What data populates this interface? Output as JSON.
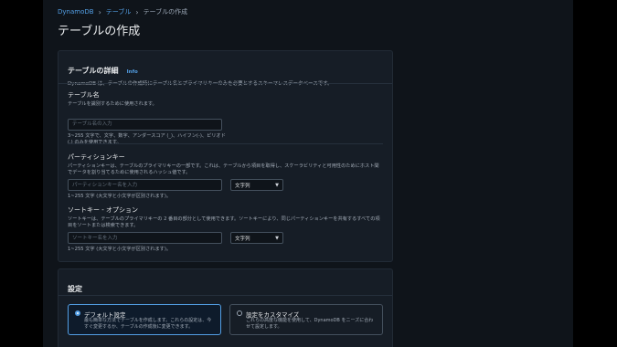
{
  "breadcrumb": {
    "root": "DynamoDB",
    "section": "テーブル",
    "current": "テーブルの作成"
  },
  "page_title": "テーブルの作成",
  "details": {
    "title": "テーブルの詳細",
    "info": "Info",
    "description": "DynamoDB は、テーブルの作成時にテーブル名とプライマリキーのみを必要とするスキーマレスデータベースです。",
    "table_name": {
      "label": "テーブル名",
      "description": "テーブルを識別するために使用されます。",
      "placeholder": "テーブル名の入力",
      "constraint": "3~255 文字で、文字、数字、アンダースコア (_)、ハイフン(-)、ピリオド (.) のみを使用できます。"
    },
    "partition_key": {
      "label": "パーティションキー",
      "description": "パーティションキーは、テーブルのプライマリキーの一部です。これは、テーブルから項目を取得し、スケーラビリティと可用性のためにホスト間でデータを割り当てるために使用されるハッシュ値です。",
      "placeholder": "パーティションキー名を入力",
      "type": "文字列",
      "constraint": "1~255 文字 (大文字と小文字が区別されます)。"
    },
    "sort_key": {
      "label": "ソートキー - オプション",
      "description": "ソートキーは、テーブルのプライマリキーの 2 番目の部分として使用できます。ソートキーにより、同じパーティションキーを共有するすべての項目をソートまたは検索できます。",
      "placeholder": "ソートキー名を入力",
      "type": "文字列",
      "constraint": "1~255 文字 (大文字と小文字が区別されます)。"
    }
  },
  "settings": {
    "title": "設定",
    "default": {
      "title": "デフォルト設定",
      "description": "最も簡単な方法でテーブルを作成します。これらの設定は、今すぐ変更するか、テーブルの作成後に変更できます。"
    },
    "custom": {
      "title": "設定をカスタマイズ",
      "description": "これらの高度な機能を使用して、DynamoDB をニーズに合わせて設定します。"
    }
  }
}
